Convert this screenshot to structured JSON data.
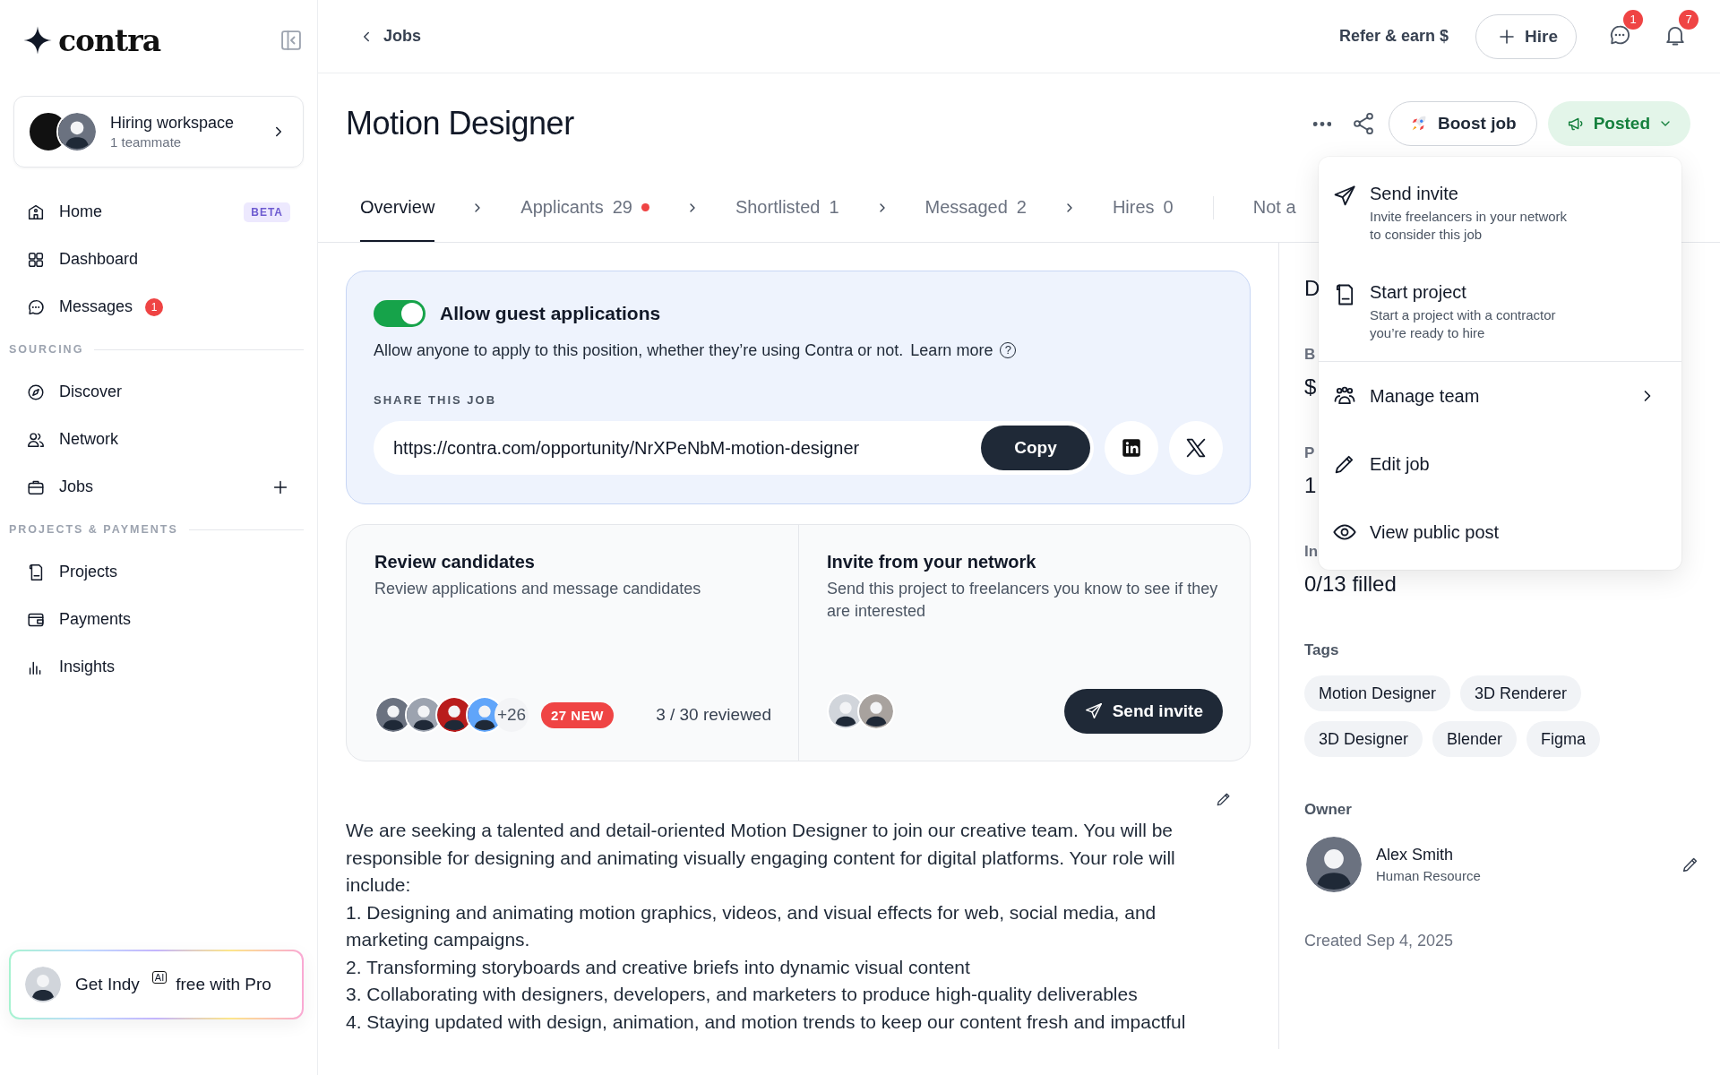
{
  "sidebar": {
    "logo": "contra",
    "workspace": {
      "title": "Hiring workspace",
      "subtitle": "1 teammate"
    },
    "items": [
      {
        "kind": "item",
        "label": "Home",
        "selected": false,
        "badge": {
          "kind": "tag",
          "text": "BETA"
        }
      },
      {
        "kind": "item",
        "label": "Dashboard",
        "selected": false
      },
      {
        "kind": "item",
        "label": "Messages",
        "selected": false,
        "badge": {
          "kind": "count",
          "text": "1"
        }
      },
      {
        "kind": "heading",
        "label": "SOURCING"
      },
      {
        "kind": "item",
        "label": "Discover",
        "selected": false
      },
      {
        "kind": "item",
        "label": "Network",
        "selected": false
      },
      {
        "kind": "item",
        "label": "Jobs",
        "selected": false,
        "add_button": true
      },
      {
        "kind": "heading",
        "label": "PROJECTS & PAYMENTS"
      },
      {
        "kind": "item",
        "label": "Projects",
        "selected": false
      },
      {
        "kind": "item",
        "label": "Payments",
        "selected": false
      },
      {
        "kind": "item",
        "label": "Insights",
        "selected": false
      }
    ],
    "promo": {
      "before": "Get Indy",
      "tag": "AI",
      "after": "free with Pro"
    }
  },
  "top_bar": {
    "back": "Jobs",
    "refer": "Refer & earn $",
    "hire": "Hire",
    "messages_badge": "1",
    "notifications_badge": "7"
  },
  "job": {
    "title": "Motion Designer",
    "boost": "Boost job",
    "status": "Posted"
  },
  "tabs": [
    {
      "kind": "stage",
      "label": "Overview",
      "selected": true
    },
    {
      "kind": "stage",
      "label": "Applicants",
      "count": "29",
      "dot": true,
      "selected": false
    },
    {
      "kind": "stage",
      "label": "Shortlisted",
      "count": "1",
      "selected": false
    },
    {
      "kind": "stage",
      "label": "Messaged",
      "count": "2",
      "selected": false
    },
    {
      "kind": "stage",
      "label": "Hires",
      "count": "0",
      "selected": false
    },
    {
      "kind": "other",
      "label": "Not a",
      "selected": false
    }
  ],
  "guest": {
    "title": "Allow guest applications",
    "on": true,
    "description": "Allow anyone to apply to this position, whether they’re using Contra or not.",
    "link": "Learn more",
    "help": "?",
    "share_heading": "SHARE THIS JOB",
    "url": "https://contra.com/opportunity/NrXPeNbM-motion-designer",
    "copy": "Copy"
  },
  "review": {
    "title": "Review candidates",
    "subtitle": "Review applications and message candidates",
    "more": "+26",
    "new_badge": "27 NEW",
    "reviewed": "3 / 30 reviewed"
  },
  "invite": {
    "title": "Invite from your network",
    "subtitle": "Send this project to freelancers you know to see if they are interested",
    "button": "Send invite"
  },
  "description": [
    "We are seeking a talented and detail-oriented Motion Designer to join our creative team. You will be responsible for designing and animating visually engaging content for digital platforms. Your role will include:",
    "1. Designing and animating motion graphics, videos, and visual effects for web, social media, and marketing campaigns.",
    "2. Transforming storyboards and creative briefs into dynamic visual content",
    "3. Collaborating with designers, developers, and marketers to produce high-quality deliverables",
    "4. Staying updated with design, animation, and motion trends to keep our content fresh and impactful"
  ],
  "details": {
    "partial": [
      {
        "kind": "heading",
        "text": "D"
      },
      {
        "kind": "label",
        "text": "B"
      },
      {
        "kind": "value",
        "text": "$"
      },
      {
        "kind": "label",
        "text": "P"
      },
      {
        "kind": "value",
        "text": "1"
      },
      {
        "kind": "label",
        "text": "In"
      },
      {
        "kind": "value",
        "text": "0/13 filled"
      }
    ],
    "tags_heading": "Tags",
    "tags": [
      "Motion Designer",
      "3D Renderer",
      "3D Designer",
      "Blender",
      "Figma"
    ],
    "owner_heading": "Owner",
    "owner": {
      "name": "Alex Smith",
      "role": "Human Resource"
    },
    "created": "Created Sep 4, 2025"
  },
  "menu": [
    {
      "kind": "detailed",
      "label": "Send invite",
      "description": "Invite freelancers in your network to consider this job"
    },
    {
      "kind": "detailed",
      "label": "Start project",
      "description": "Start a project with a contractor you’re ready to hire"
    },
    {
      "kind": "simple",
      "label": "Manage team",
      "submenu": true
    },
    {
      "kind": "simple",
      "label": "Edit job",
      "submenu": false
    },
    {
      "kind": "simple",
      "label": "View public post",
      "submenu": false
    }
  ]
}
